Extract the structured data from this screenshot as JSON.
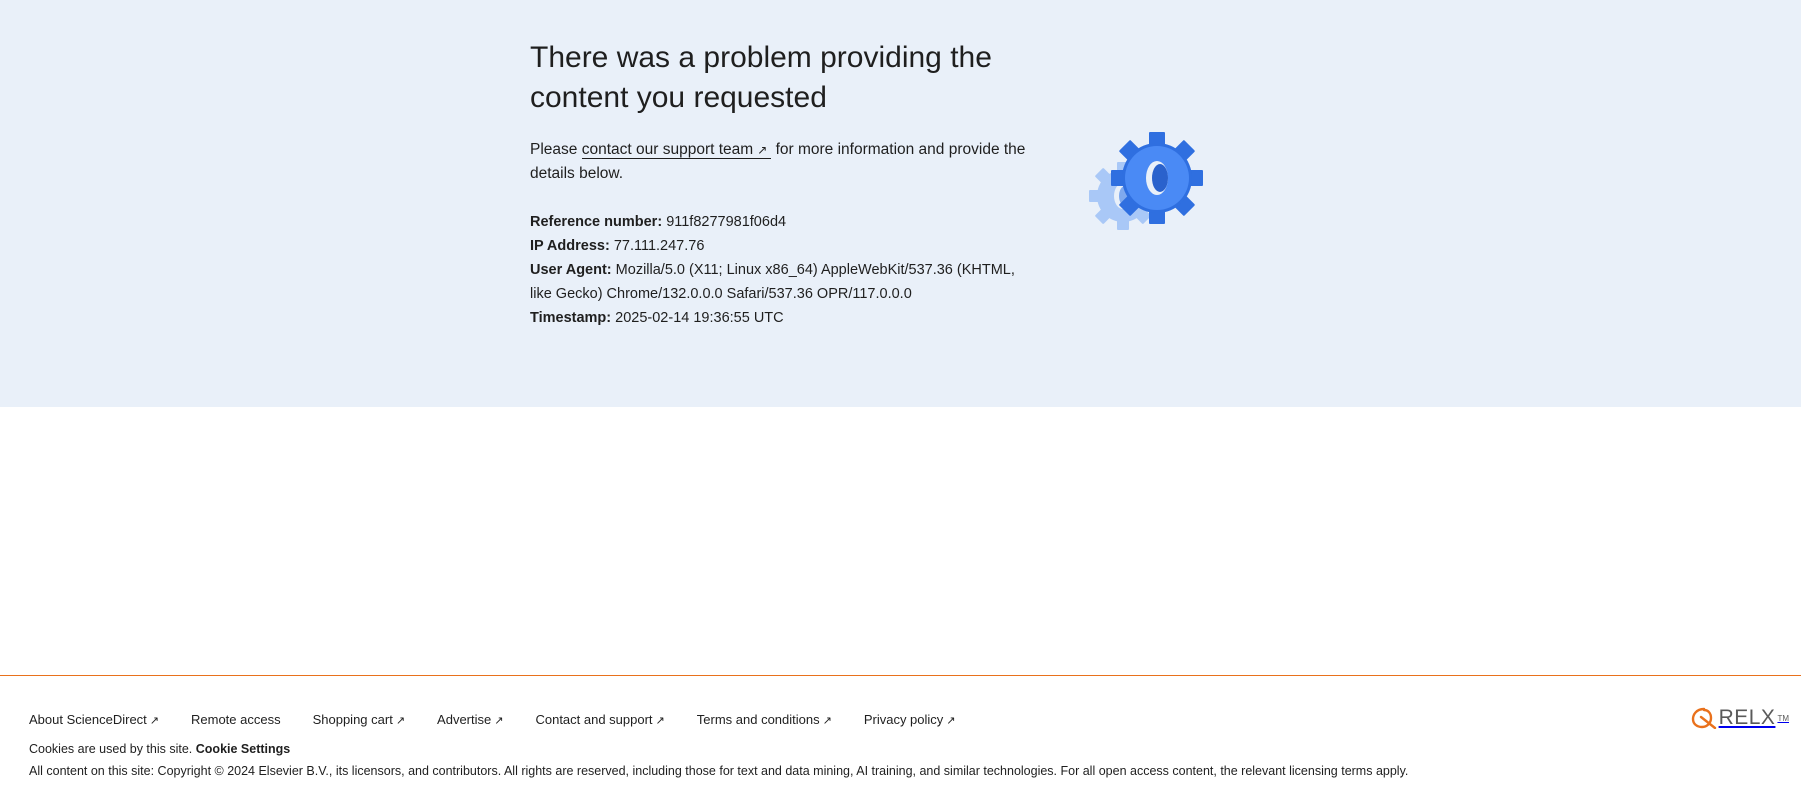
{
  "hero": {
    "title": "There was a problem providing the content you requested",
    "intro_before": "Please",
    "support_link": "contact our support team",
    "intro_after": "for more information and provide the details below.",
    "details": [
      {
        "label": "Reference number:",
        "value": "911f8277981f06d4"
      },
      {
        "label": "IP Address:",
        "value": "77.111.247.76"
      },
      {
        "label": "User Agent:",
        "value": "Mozilla/5.0 (X11; Linux x86_64) AppleWebKit/537.36 (KHTML, like Gecko) Chrome/132.0.0.0 Safari/537.36 OPR/117.0.0.0"
      },
      {
        "label": "Timestamp:",
        "value": "2025-02-14 19:36:55 UTC"
      }
    ],
    "illustration_icon": "gears-icon",
    "colors": {
      "background": "#e9f0f9",
      "gear_dark": "#3b7ef0",
      "gear_light": "#a9c8f7"
    }
  },
  "footer": {
    "links": [
      {
        "label": "About ScienceDirect",
        "external": true
      },
      {
        "label": "Remote access",
        "external": false
      },
      {
        "label": "Shopping cart",
        "external": true
      },
      {
        "label": "Advertise",
        "external": true
      },
      {
        "label": "Contact and support",
        "external": true
      },
      {
        "label": "Terms and conditions",
        "external": true
      },
      {
        "label": "Privacy policy",
        "external": true
      }
    ],
    "cookie_text": "Cookies are used by this site.",
    "cookie_settings": "Cookie Settings",
    "copyright": "All content on this site: Copyright © 2024 Elsevier B.V., its licensors, and contributors. All rights are reserved, including those for text and data mining, AI training, and similar technologies. For all open access content, the relevant licensing terms apply.",
    "logo_text": "RELX",
    "logo_tm": "TM",
    "accent_color": "#e9711c"
  }
}
